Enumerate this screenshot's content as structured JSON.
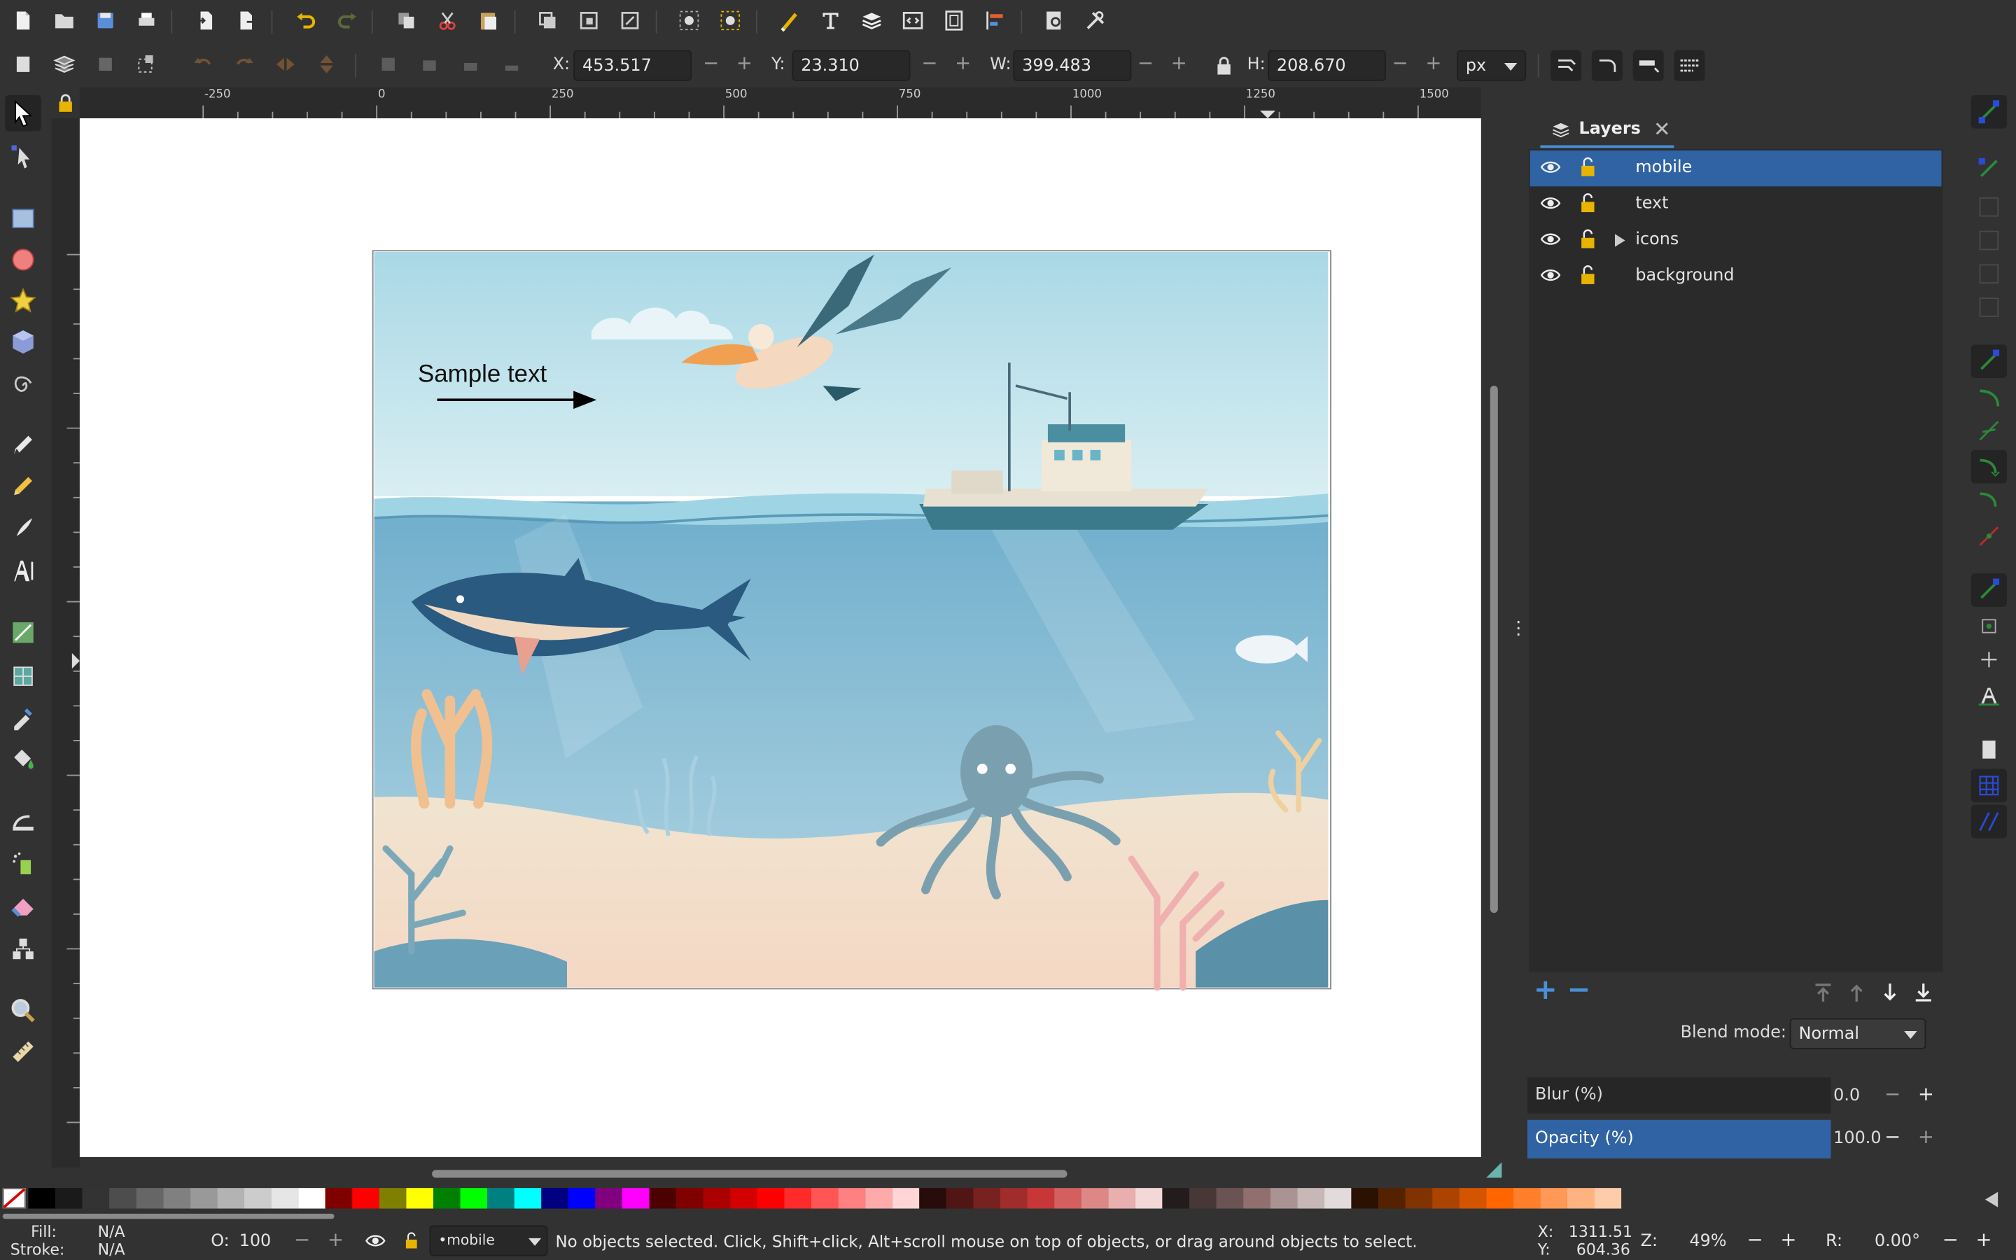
{
  "toolbar": {
    "x_label": "X:",
    "x_value": "453.517",
    "y_label": "Y:",
    "y_value": "23.310",
    "w_label": "W:",
    "w_value": "399.483",
    "h_label": "H:",
    "h_value": "208.670",
    "unit": "px"
  },
  "ruler": {
    "ticks": [
      "-250",
      "0",
      "250",
      "500",
      "750",
      "1000",
      "1250",
      "1500"
    ]
  },
  "canvas": {
    "sample_text": "Sample text"
  },
  "layers_panel": {
    "title": "Layers",
    "layers": [
      {
        "name": "mobile",
        "selected": true
      },
      {
        "name": "text",
        "selected": false
      },
      {
        "name": "icons",
        "selected": false
      },
      {
        "name": "background",
        "selected": false
      }
    ],
    "blend_label": "Blend mode:",
    "blend_value": "Normal",
    "blur_label": "Blur (%)",
    "blur_value": "0.0",
    "opacity_label": "Opacity (%)",
    "opacity_value": "100.0"
  },
  "palette": [
    "#000000",
    "#1a1a1a",
    "#333333",
    "#4d4d4d",
    "#666666",
    "#808080",
    "#999999",
    "#b3b3b3",
    "#cccccc",
    "#e6e6e6",
    "#ffffff",
    "#800000",
    "#ff0000",
    "#808000",
    "#ffff00",
    "#008000",
    "#00ff00",
    "#008080",
    "#00ffff",
    "#000080",
    "#0000ff",
    "#800080",
    "#ff00ff",
    "#4d0000",
    "#800000",
    "#aa0000",
    "#d40000",
    "#ff0000",
    "#ff2a2a",
    "#ff5555",
    "#ff8080",
    "#ffaaaa",
    "#ffd5d5",
    "#280b0b",
    "#501616",
    "#782121",
    "#a02c2c",
    "#c83737",
    "#d35f5f",
    "#de8787",
    "#e9afaf",
    "#f4d7d7",
    "#241c1c",
    "#483737",
    "#6c5353",
    "#916f6f",
    "#ac9393",
    "#c8b7b7",
    "#e3dbdb",
    "#2b1100",
    "#552200",
    "#803300",
    "#aa4400",
    "#d45500",
    "#ff6600",
    "#ff7f2a",
    "#ff9955",
    "#ffb380",
    "#ffccaa"
  ],
  "statusbar": {
    "fill_label": "Fill:",
    "fill_value": "N/A",
    "stroke_label": "Stroke:",
    "stroke_value": "N/A",
    "o_label": "O:",
    "o_value": "100",
    "layer_value": "•mobile",
    "message": "No objects selected. Click, Shift+click, Alt+scroll mouse on top of objects, or drag around objects to select.",
    "x_label": "X:",
    "x_value": "1311.51",
    "y_label": "Y:",
    "y_value": "604.36",
    "z_label": "Z:",
    "z_value": "49%",
    "r_label": "R:",
    "r_value": "0.00°"
  }
}
